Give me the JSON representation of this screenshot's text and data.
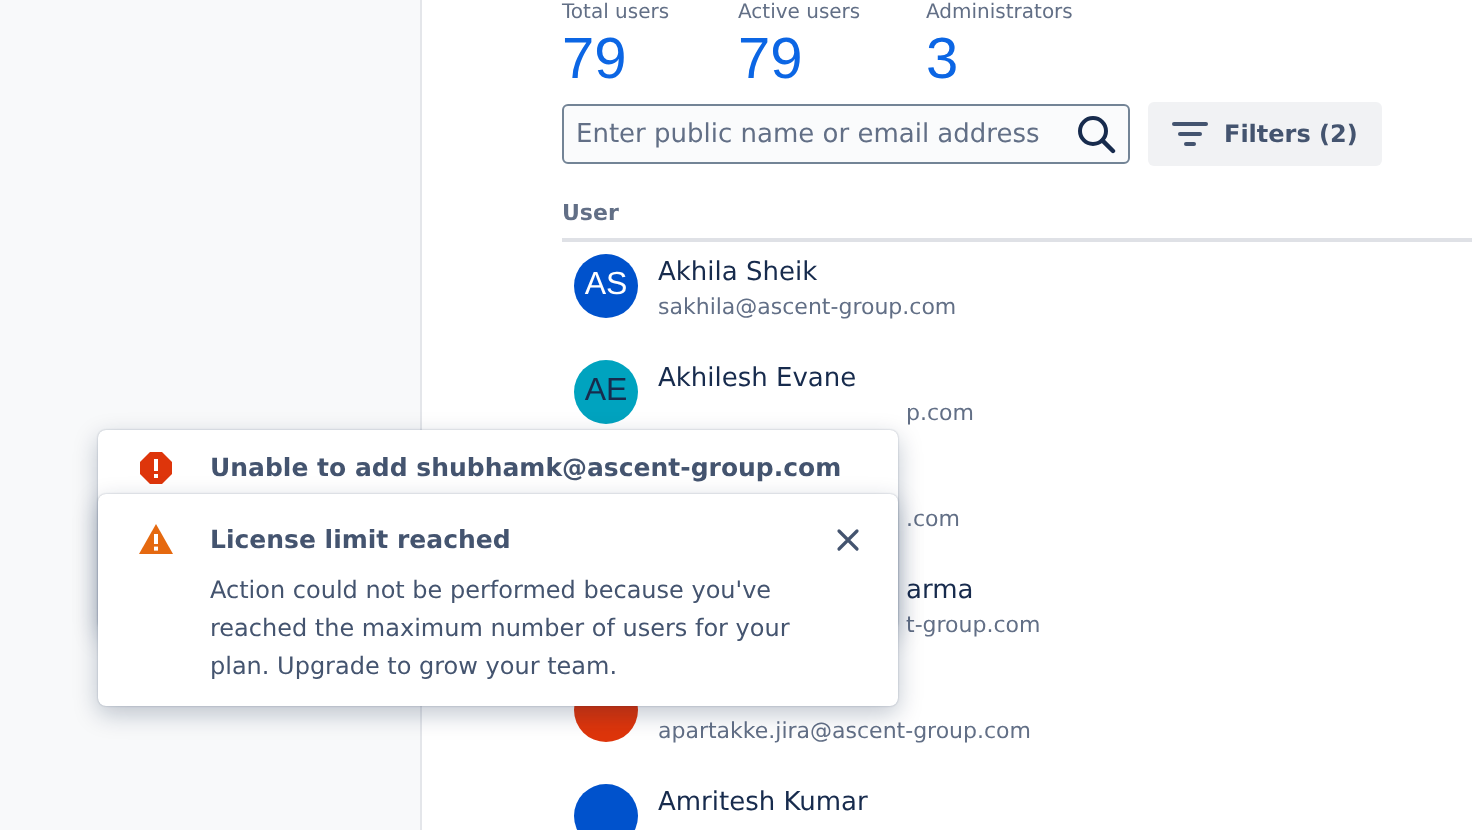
{
  "stats": [
    {
      "label": "Total users",
      "value": "79"
    },
    {
      "label": "Active users",
      "value": "79"
    },
    {
      "label": "Administrators",
      "value": "3"
    }
  ],
  "search": {
    "placeholder": "Enter public name or email address"
  },
  "filters_button": {
    "label": "Filters (2)"
  },
  "table": {
    "columns": [
      "User"
    ],
    "rows": [
      {
        "initials": "AS",
        "color": "#0052cc",
        "name": "Akhila Sheik",
        "email": "sakhila@ascent-group.com"
      },
      {
        "initials": "AE",
        "color": "#00a3bf",
        "name": "Akhilesh Evane",
        "email_fragment": "p.com"
      },
      {
        "email_fragment": ".com"
      },
      {
        "name_fragment": "arma",
        "email_fragment": "t-group.com"
      },
      {
        "color": "#de350b",
        "email": "apartakke.jira@ascent-group.com"
      },
      {
        "color": "#0052cc",
        "name": "Amritesh Kumar"
      }
    ]
  },
  "toasts": [
    {
      "kind": "error",
      "title": "Unable to add shubhamk@ascent-group.com"
    },
    {
      "kind": "warning",
      "title": "License limit reached",
      "body": "Action could not be performed because you've reached the maximum number of users for your plan. Upgrade to grow your team.",
      "closable": true
    }
  ]
}
